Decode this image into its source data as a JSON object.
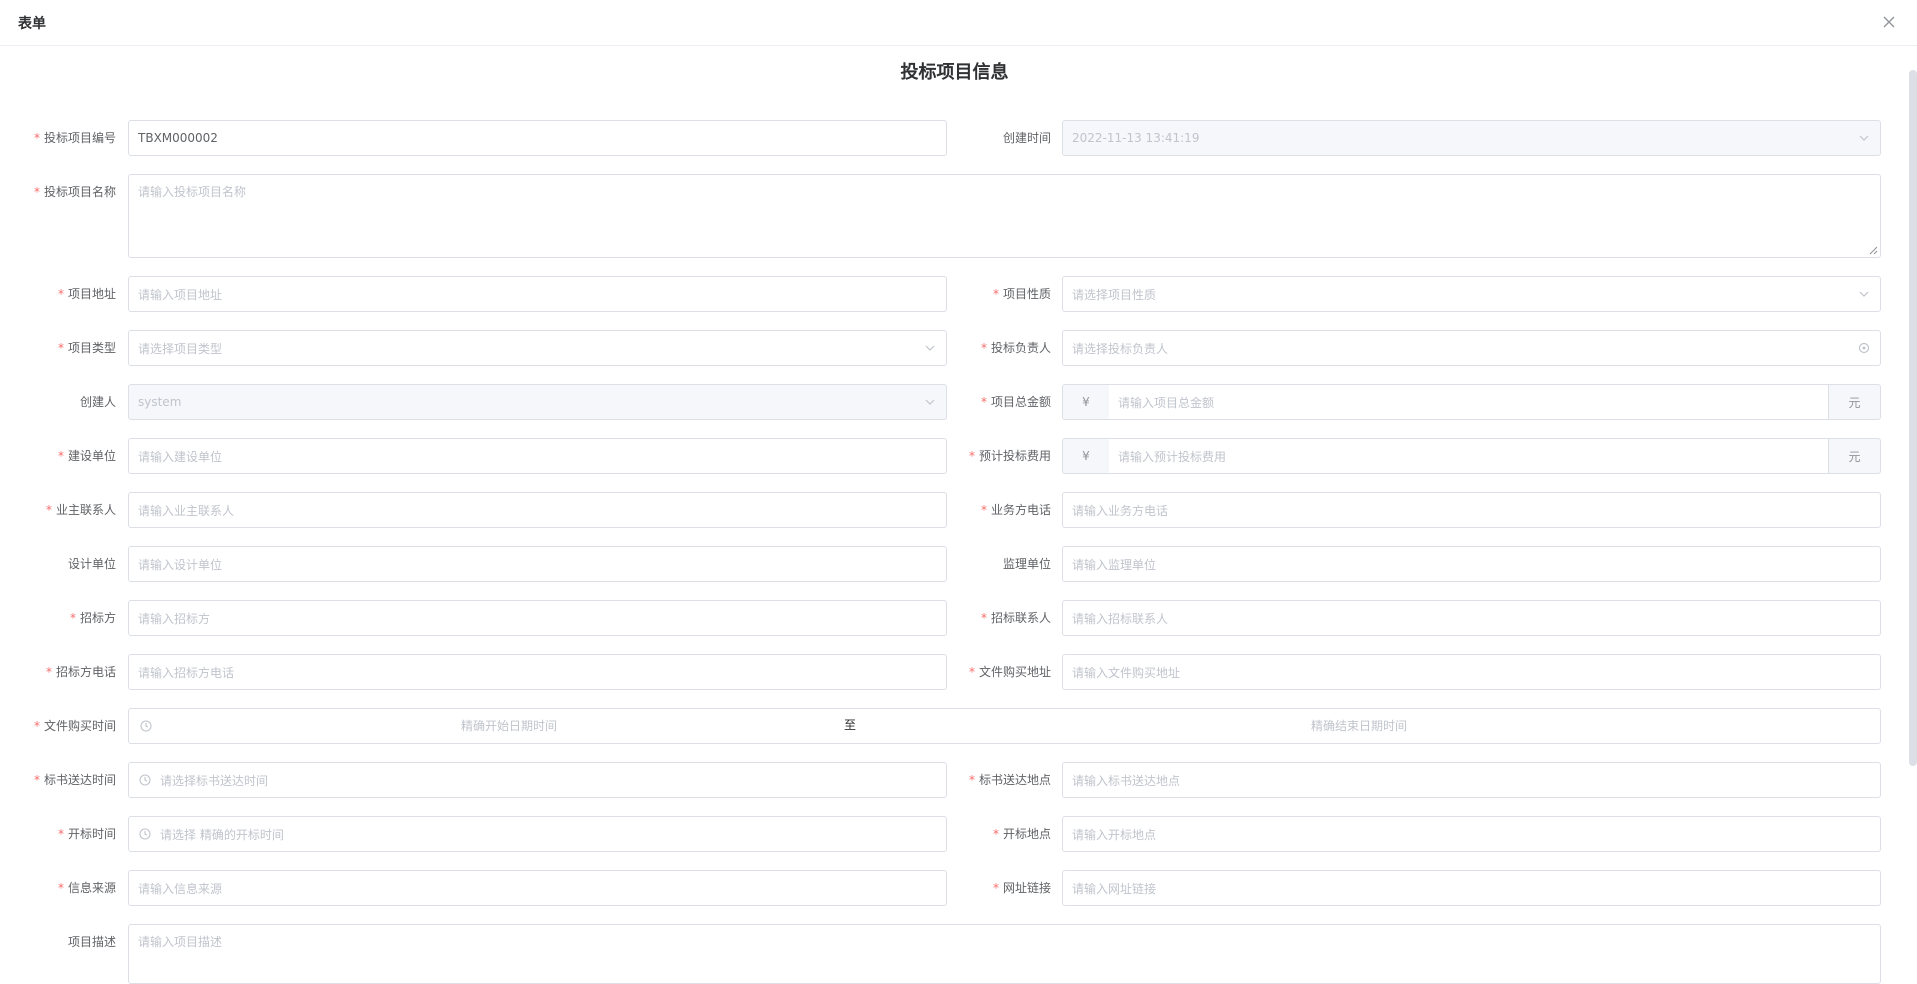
{
  "dialog": {
    "title": "表单"
  },
  "form": {
    "title": "投标项目信息",
    "fields": {
      "project_no": {
        "label": "投标项目编号",
        "value": "TBXM000002"
      },
      "created_time": {
        "label": "创建时间",
        "value": "2022-11-13 13:41:19"
      },
      "project_name": {
        "label": "投标项目名称",
        "placeholder": "请输入投标项目名称"
      },
      "project_address": {
        "label": "项目地址",
        "placeholder": "请输入项目地址"
      },
      "project_nature": {
        "label": "项目性质",
        "placeholder": "请选择项目性质"
      },
      "project_type": {
        "label": "项目类型",
        "placeholder": "请选择项目类型"
      },
      "bid_owner": {
        "label": "投标负责人",
        "placeholder": "请选择投标负责人"
      },
      "creator": {
        "label": "创建人",
        "value": "system"
      },
      "total_amount": {
        "label": "项目总金额",
        "placeholder": "请输入项目总金额",
        "prefix": "¥",
        "suffix": "元"
      },
      "construction_unit": {
        "label": "建设单位",
        "placeholder": "请输入建设单位"
      },
      "estimated_cost": {
        "label": "预计投标费用",
        "placeholder": "请输入预计投标费用",
        "prefix": "¥",
        "suffix": "元"
      },
      "owner_contact": {
        "label": "业主联系人",
        "placeholder": "请输入业主联系人"
      },
      "business_phone": {
        "label": "业务方电话",
        "placeholder": "请输入业务方电话"
      },
      "design_unit": {
        "label": "设计单位",
        "placeholder": "请输入设计单位"
      },
      "supervision_unit": {
        "label": "监理单位",
        "placeholder": "请输入监理单位"
      },
      "tenderer": {
        "label": "招标方",
        "placeholder": "请输入招标方"
      },
      "tender_contact": {
        "label": "招标联系人",
        "placeholder": "请输入招标联系人"
      },
      "tender_phone": {
        "label": "招标方电话",
        "placeholder": "请输入招标方电话"
      },
      "doc_purchase_address": {
        "label": "文件购买地址",
        "placeholder": "请输入文件购买地址"
      },
      "doc_purchase_time": {
        "label": "文件购买时间",
        "start_placeholder": "精确开始日期时间",
        "separator": "至",
        "end_placeholder": "精确结束日期时间"
      },
      "bid_delivery_time": {
        "label": "标书送达时间",
        "placeholder": "请选择标书送达时间"
      },
      "bid_delivery_place": {
        "label": "标书送达地点",
        "placeholder": "请输入标书送达地点"
      },
      "bid_open_time": {
        "label": "开标时间",
        "placeholder": "请选择 精确的开标时间"
      },
      "bid_open_place": {
        "label": "开标地点",
        "placeholder": "请输入开标地点"
      },
      "info_source": {
        "label": "信息来源",
        "placeholder": "请输入信息来源"
      },
      "website_link": {
        "label": "网址链接",
        "placeholder": "请输入网址链接"
      },
      "description": {
        "label": "项目描述",
        "placeholder": "请输入项目描述"
      }
    }
  },
  "icons": {
    "close": "close-icon",
    "chevron": "chevron-down-icon",
    "clock": "clock-icon",
    "user_select": "circle-icon"
  },
  "colors": {
    "required": "#f56c6c",
    "border": "#dcdfe6",
    "disabled_bg": "#f5f7fa",
    "placeholder": "#c0c4cc"
  }
}
